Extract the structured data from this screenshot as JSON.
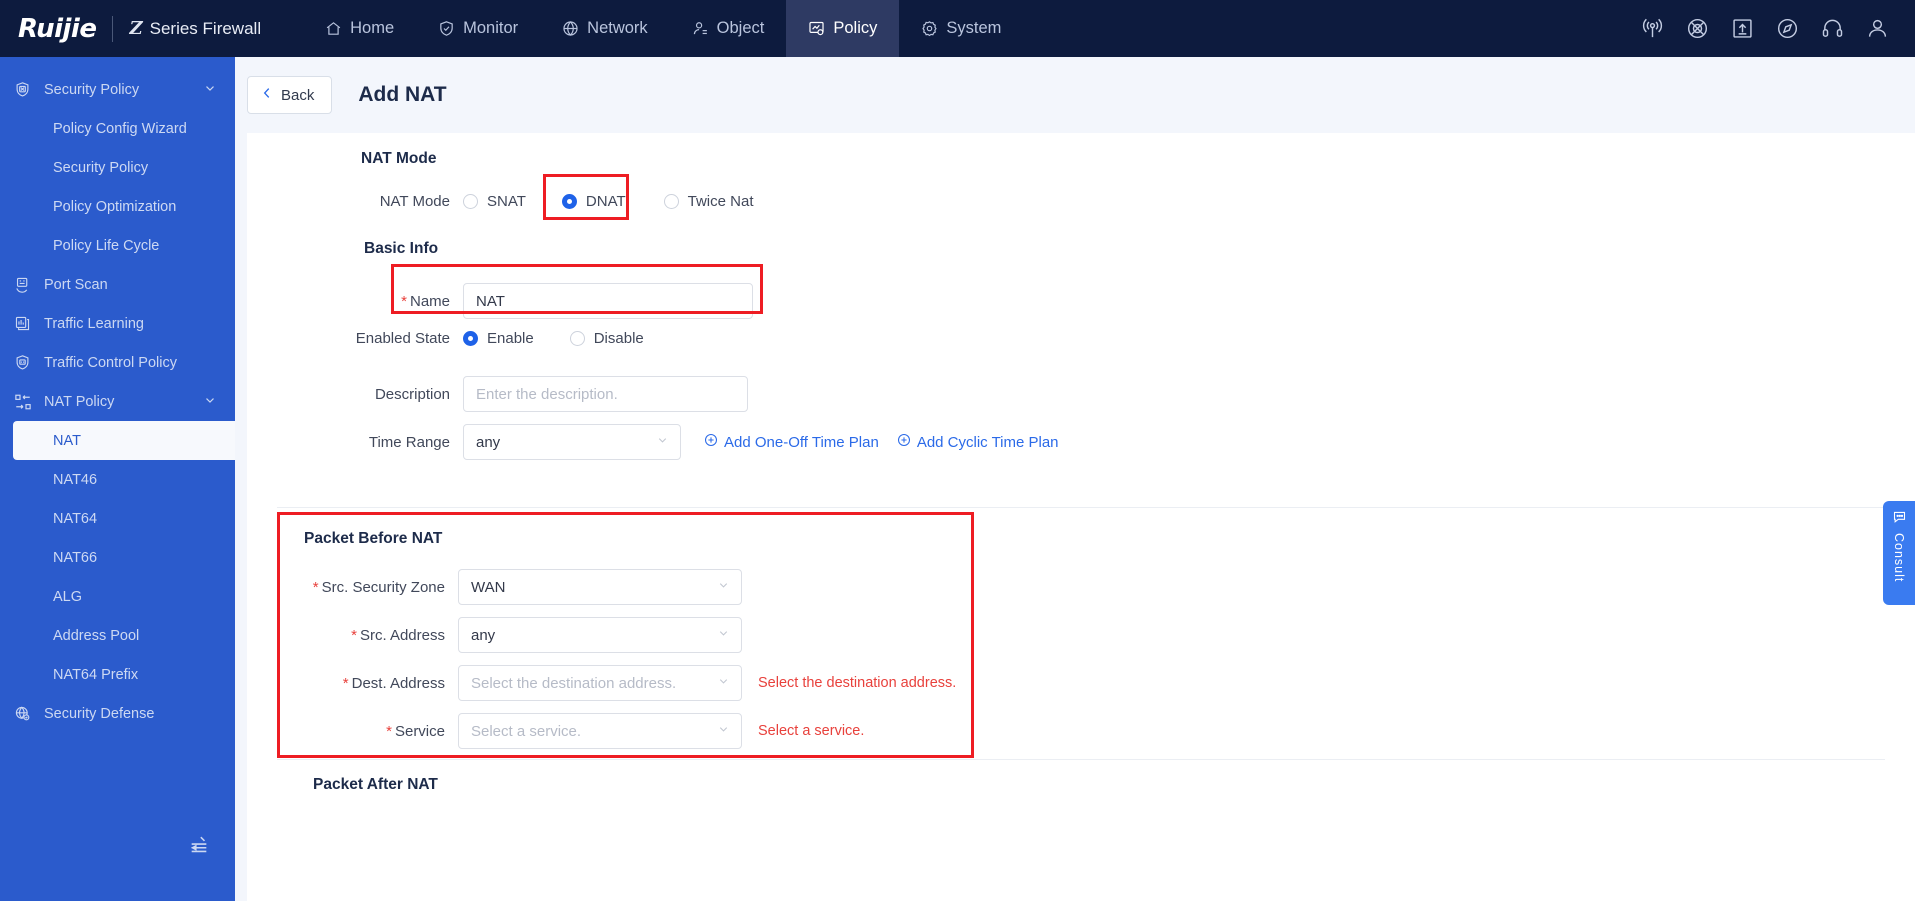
{
  "topnav": {
    "brand_logo": "Ruijie",
    "brand_sub": "Series Firewall",
    "brand_z": "Z",
    "items": [
      {
        "label": "Home",
        "icon": "home-icon",
        "active": false
      },
      {
        "label": "Monitor",
        "icon": "shield-check-icon",
        "active": false
      },
      {
        "label": "Network",
        "icon": "globe-icon",
        "active": false
      },
      {
        "label": "Object",
        "icon": "user-object-icon",
        "active": false
      },
      {
        "label": "Policy",
        "icon": "policy-icon",
        "active": true
      },
      {
        "label": "System",
        "icon": "gear-icon",
        "active": false
      }
    ],
    "right_icons": [
      "broadcast-icon",
      "network-globe-icon",
      "upload-icon",
      "compass-icon",
      "headset-icon",
      "account-icon"
    ]
  },
  "sidebar": {
    "groups": [
      {
        "label": "Security Policy",
        "icon": "security-policy-icon",
        "expanded": true,
        "children": [
          "Policy Config Wizard",
          "Security Policy",
          "Policy Optimization",
          "Policy Life Cycle"
        ]
      }
    ],
    "items": [
      {
        "label": "Port Scan",
        "icon": "port-scan-icon"
      },
      {
        "label": "Traffic Learning",
        "icon": "traffic-learning-icon"
      },
      {
        "label": "Traffic Control Policy",
        "icon": "traffic-control-icon"
      }
    ],
    "nat_group": {
      "label": "NAT Policy",
      "icon": "nat-policy-icon",
      "expanded": true,
      "children": [
        {
          "label": "NAT",
          "active": true
        },
        {
          "label": "NAT46",
          "active": false
        },
        {
          "label": "NAT64",
          "active": false
        },
        {
          "label": "NAT66",
          "active": false
        },
        {
          "label": "ALG",
          "active": false
        },
        {
          "label": "Address Pool",
          "active": false
        },
        {
          "label": "NAT64 Prefix",
          "active": false
        }
      ]
    },
    "bottom_item": {
      "label": "Security Defense",
      "icon": "security-defense-icon"
    },
    "collapse_icon": "collapse-sidebar-icon"
  },
  "page": {
    "back_label": "Back",
    "title": "Add NAT"
  },
  "form": {
    "nat_mode_section": {
      "title": "NAT Mode",
      "field_label": "NAT Mode",
      "options": [
        {
          "label": "SNAT",
          "selected": false
        },
        {
          "label": "DNAT",
          "selected": true
        },
        {
          "label": "Twice Nat",
          "selected": false
        }
      ]
    },
    "basic_info": {
      "title": "Basic Info",
      "name": {
        "label": "Name",
        "required": true,
        "value": "NAT"
      },
      "enabled_state": {
        "label": "Enabled State",
        "options": [
          {
            "label": "Enable",
            "selected": true
          },
          {
            "label": "Disable",
            "selected": false
          }
        ]
      },
      "description": {
        "label": "Description",
        "value": "",
        "placeholder": "Enter the description."
      },
      "time_range": {
        "label": "Time Range",
        "value": "any",
        "links": [
          {
            "label": "Add One-Off Time Plan",
            "icon": "plus-circle-icon"
          },
          {
            "label": "Add Cyclic Time Plan",
            "icon": "plus-circle-icon"
          }
        ]
      }
    },
    "packet_before_nat": {
      "title": "Packet Before NAT",
      "fields": [
        {
          "label": "Src. Security Zone",
          "required": true,
          "value": "WAN",
          "placeholder": "",
          "error": ""
        },
        {
          "label": "Src. Address",
          "required": true,
          "value": "any",
          "placeholder": "",
          "error": ""
        },
        {
          "label": "Dest. Address",
          "required": true,
          "value": "",
          "placeholder": "Select the destination address.",
          "error": "Select the destination address."
        },
        {
          "label": "Service",
          "required": true,
          "value": "",
          "placeholder": "Select a service.",
          "error": "Select a service."
        }
      ]
    },
    "packet_after_nat": {
      "title": "Packet After NAT"
    }
  },
  "consult": {
    "label": "Consult",
    "icon": "consult-icon"
  },
  "colors": {
    "nav_bg": "#0d1b3e",
    "sidebar_bg": "#2b5bcc",
    "accent": "#1f62e8",
    "link": "#2b6ae8",
    "error": "#e8413c",
    "highlight": "#ee1d23"
  }
}
